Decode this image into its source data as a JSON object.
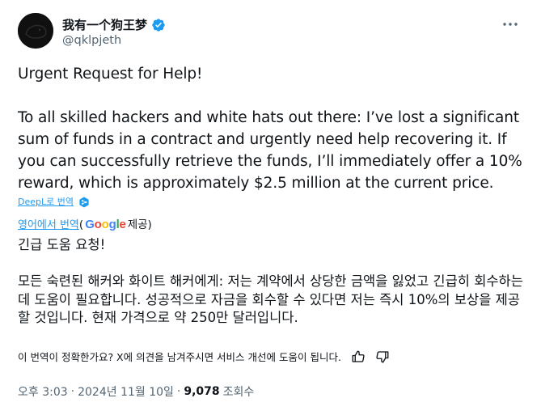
{
  "author": {
    "display_name": "我有一个狗王梦",
    "handle": "@qklpjeth",
    "verified": true
  },
  "icons": {
    "verified": "verified-badge-icon",
    "more": "more-options-icon",
    "deepl": "deepl-icon",
    "thumbs_up": "thumbs-up-icon",
    "thumbs_down": "thumbs-down-icon"
  },
  "tweet": {
    "text": "Urgent Request for Help!\n\nTo all skilled hackers and white hats out there: I’ve lost a significant sum of funds in a contract and urgently need help recovering it. If you can successfully retrieve the funds, I’ll immediately offer a 10% reward, which is approximately $2.5 million at the current price."
  },
  "translation": {
    "deepl_label": "DeepL로 번역",
    "google_prefix_link": "영어에서 번역",
    "google_open_paren": "(",
    "google_logo": "Google",
    "google_suffix": " 제공)",
    "text": "긴급 도움 요청!\n\n모든 숙련된 해커와 화이트 해커에게: 저는 계약에서 상당한 금액을 잃었고 긴급히 회수하는 데 도움이 필요합니다. 성공적으로 자금을 회수할 수 있다면 저는 즉시 10%의 보상을 제공할 것입니다. 현재 가격으로 약 250만 달러입니다.",
    "feedback_prompt": "이 번역이 정확한가요? X에 의견을 남겨주시면 서비스 개선에 도움이 됩니다."
  },
  "meta": {
    "time": "오후 3:03",
    "separator": "·",
    "date": "2024년 11월 10일",
    "views_count": "9,078",
    "views_label": "조회수"
  },
  "colors": {
    "link": "#1d9bf0",
    "secondary_text": "#536471",
    "primary_text": "#0f1419",
    "verified": "#1d9bf0"
  }
}
